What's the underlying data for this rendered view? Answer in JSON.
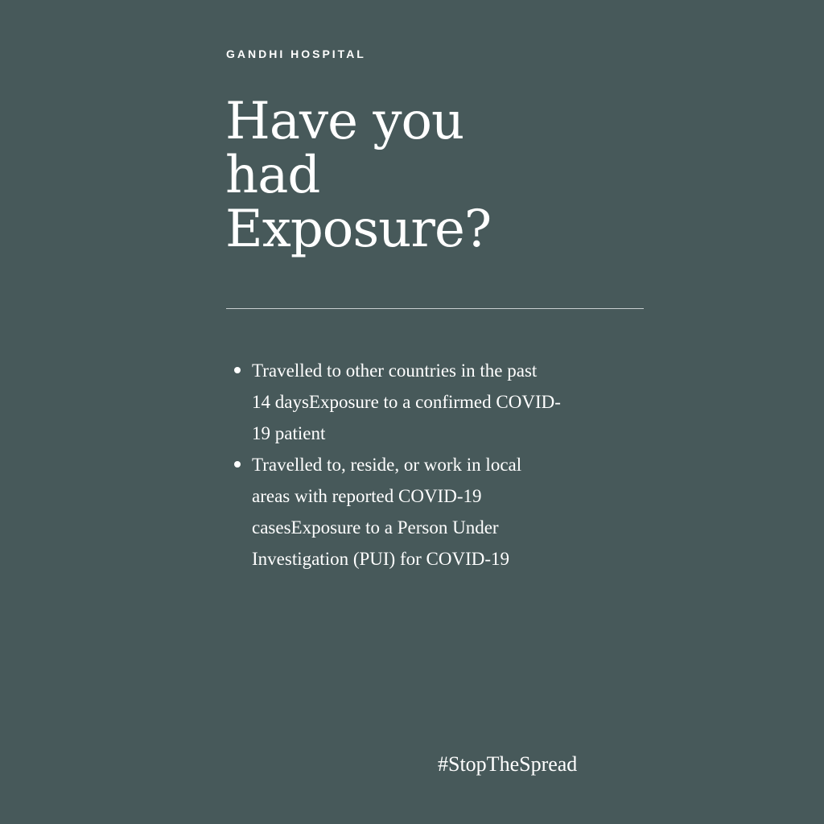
{
  "org": "GANDHI HOSPITAL",
  "headline": {
    "lines": [
      "Have you",
      "had",
      "Exposure?"
    ]
  },
  "bullets": [
    {
      "lines": [
        "Travelled to other countries in the past",
        "14 daysExposure to a confirmed COVID-",
        "19 patient"
      ]
    },
    {
      "lines": [
        "Travelled to, reside, or work in local",
        "areas with reported COVID-19",
        "casesExposure to a Person Under",
        "Investigation (PUI) for COVID-19"
      ]
    }
  ],
  "hashtag": "#StopTheSpread",
  "colors": {
    "background": "#47595A",
    "text": "#FFFFFF",
    "divider": "#C9D0D0"
  }
}
